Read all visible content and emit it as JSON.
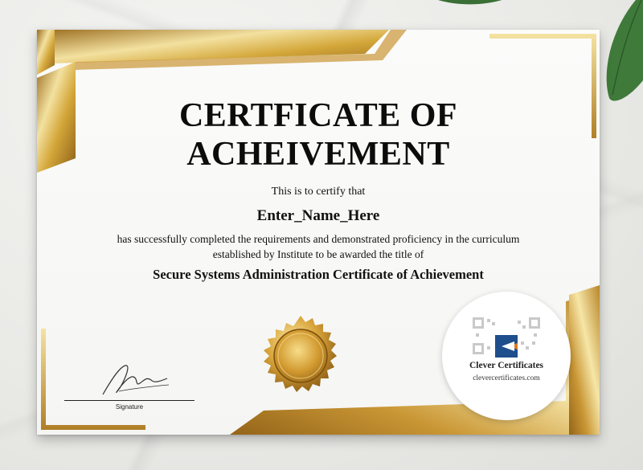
{
  "certificate": {
    "title_line1": "CERTFICATE OF",
    "title_line2": "ACHEIVEMENT",
    "certify_text": "This is to certify that",
    "recipient_name": "Enter_Name_Here",
    "body_line1": "has successfully completed the requirements and demonstrated proficiency in the curriculum",
    "body_line2": "established by Institute to be awarded the title of",
    "award_title": "Secure Systems Administration Certificate of Achievement",
    "signature_label": "Signature"
  },
  "badge": {
    "brand_name": "Clever Certificates",
    "url": "clevercertificates.com"
  },
  "colors": {
    "gold_light": "#f3e1a0",
    "gold_mid": "#d4a73a",
    "gold_dark": "#9a6c1e",
    "paper": "#f7f7f5",
    "text": "#111111",
    "logo_blue": "#1f4e8c",
    "logo_orange": "#e07a1f",
    "leaf_green": "#3f7a3a"
  },
  "icons": {
    "seal": "gold-seal-icon",
    "logo": "clever-certificates-logo-icon",
    "qr": "qr-code-icon",
    "signature": "signature-mark"
  }
}
